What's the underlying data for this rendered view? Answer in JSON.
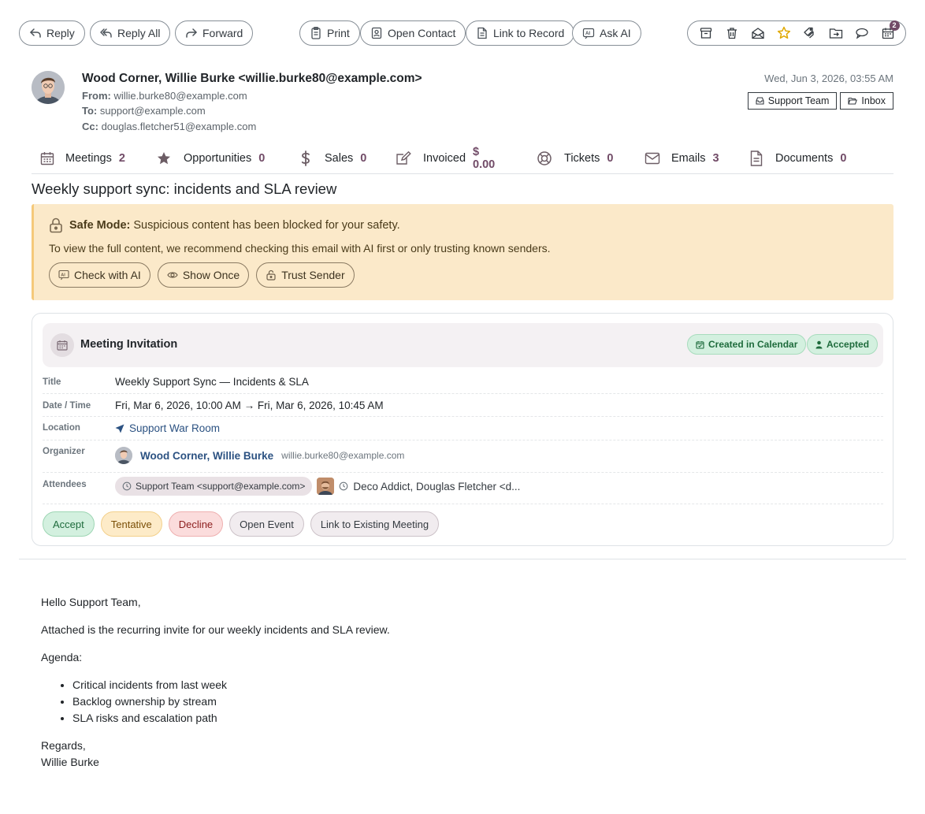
{
  "toolbar": {
    "reply": "Reply",
    "reply_all": "Reply All",
    "forward": "Forward",
    "print": "Print",
    "open_contact": "Open Contact",
    "link_to_record": "Link to Record",
    "ask_ai": "Ask AI",
    "icon_actions": [
      "archive-icon",
      "trash-icon",
      "mark-unread-icon",
      "star-icon",
      "tag-icon",
      "move-folder-icon",
      "chat-icon",
      "calendar-icon"
    ],
    "calendar_badge": "2",
    "star_color": "#e0a800"
  },
  "header": {
    "sender_line": "Wood Corner, Willie Burke <willie.burke80@example.com>",
    "from_label": "From:",
    "from_value": "willie.burke80@example.com",
    "to_label": "To:",
    "to_value": "support@example.com",
    "cc_label": "Cc:",
    "cc_value": "douglas.fletcher51@example.com",
    "date": "Wed, Jun 3, 2026, 03:55 AM",
    "tags": [
      "Support Team",
      "Inbox"
    ]
  },
  "stats": [
    {
      "label": "Meetings",
      "count": "2",
      "icon": "calendar-icon"
    },
    {
      "label": "Opportunities",
      "count": "0",
      "icon": "star-icon"
    },
    {
      "label": "Sales",
      "count": "0",
      "icon": "dollar-icon"
    },
    {
      "label": "Invoiced",
      "count": "$ 0.00",
      "icon": "edit-icon"
    },
    {
      "label": "Tickets",
      "count": "0",
      "icon": "lifebuoy-icon"
    },
    {
      "label": "Emails",
      "count": "3",
      "icon": "envelope-icon"
    },
    {
      "label": "Documents",
      "count": "0",
      "icon": "document-icon"
    }
  ],
  "subject": "Weekly support sync: incidents and SLA review",
  "safe_mode": {
    "title": "Safe Mode:",
    "message": "Suspicious content has been blocked for your safety.",
    "advice": "To view the full content, we recommend checking this email with AI first or only trusting known senders.",
    "buttons": [
      "Check with AI",
      "Show Once",
      "Trust Sender"
    ],
    "background": "#fbe9c9"
  },
  "meeting": {
    "heading": "Meeting Invitation",
    "status_created": "Created in Calendar",
    "status_accepted": "Accepted",
    "rows": {
      "title_label": "Title",
      "title_value": "Weekly Support Sync — Incidents & SLA",
      "datetime_label": "Date / Time",
      "datetime_value": "Fri, Mar 6, 2026, 10:00 AM → Fri, Mar 6, 2026, 10:45 AM",
      "location_label": "Location",
      "location_value": "Support War Room",
      "organizer_label": "Organizer",
      "organizer_name": "Wood Corner, Willie Burke",
      "organizer_email": "willie.burke80@example.com",
      "attendees_label": "Attendees",
      "attendee_chip": "Support Team <support@example.com>",
      "attendee_other": "Deco Addict, Douglas Fletcher <d..."
    },
    "actions": [
      "Accept",
      "Tentative",
      "Decline",
      "Open Event",
      "Link to Existing Meeting"
    ]
  },
  "body": {
    "greeting": "Hello Support Team,",
    "intro": "Attached is the recurring invite for our weekly incidents and SLA review.",
    "agenda_label": "Agenda:",
    "agenda": [
      "Critical incidents from last week",
      "Backlog ownership by stream",
      "SLA risks and escalation path"
    ],
    "closing": "Regards,",
    "signature": "Willie Burke"
  },
  "colors": {
    "accent": "#714b67",
    "link": "#2c5282"
  }
}
